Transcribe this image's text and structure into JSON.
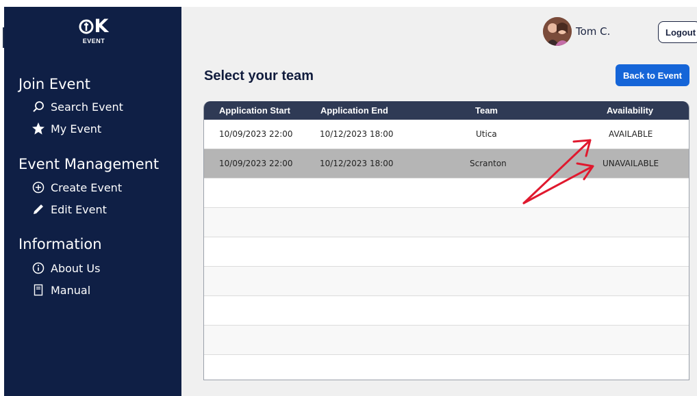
{
  "sidebar": {
    "logo_mark": "OK",
    "logo_sub": "EVENT",
    "sections": [
      {
        "title": "Join Event",
        "items": [
          {
            "label": "Search Event",
            "icon": "search-icon"
          },
          {
            "label": "My Event",
            "icon": "star-icon"
          }
        ]
      },
      {
        "title": "Event Management",
        "items": [
          {
            "label": "Create Event",
            "icon": "plus-circle-icon"
          },
          {
            "label": "Edit Event",
            "icon": "pencil-icon"
          }
        ]
      },
      {
        "title": "Information",
        "items": [
          {
            "label": "About Us",
            "icon": "info-circle-icon"
          },
          {
            "label": "Manual",
            "icon": "document-icon"
          }
        ]
      }
    ]
  },
  "header": {
    "user_name": "Tom C.",
    "logout_label": "Logout"
  },
  "main": {
    "title": "Select your team",
    "back_label": "Back to Event",
    "table": {
      "columns": [
        "Application Start",
        "Application End",
        "Team",
        "Availability"
      ],
      "rows": [
        {
          "start": "10/09/2023 22:00",
          "end": "10/12/2023 18:00",
          "team": "Utica",
          "availability": "AVAILABLE",
          "selected": false
        },
        {
          "start": "10/09/2023 22:00",
          "end": "10/12/2023 18:00",
          "team": "Scranton",
          "availability": "UNAVAILABLE",
          "selected": true
        }
      ],
      "empty_rows": 7
    }
  },
  "colors": {
    "sidebar_bg": "#0f1f45",
    "table_header_bg": "#2f3a55",
    "accent_blue": "#1565d8",
    "selected_row": "#b5b5b5",
    "annotation_red": "#e0192e"
  }
}
